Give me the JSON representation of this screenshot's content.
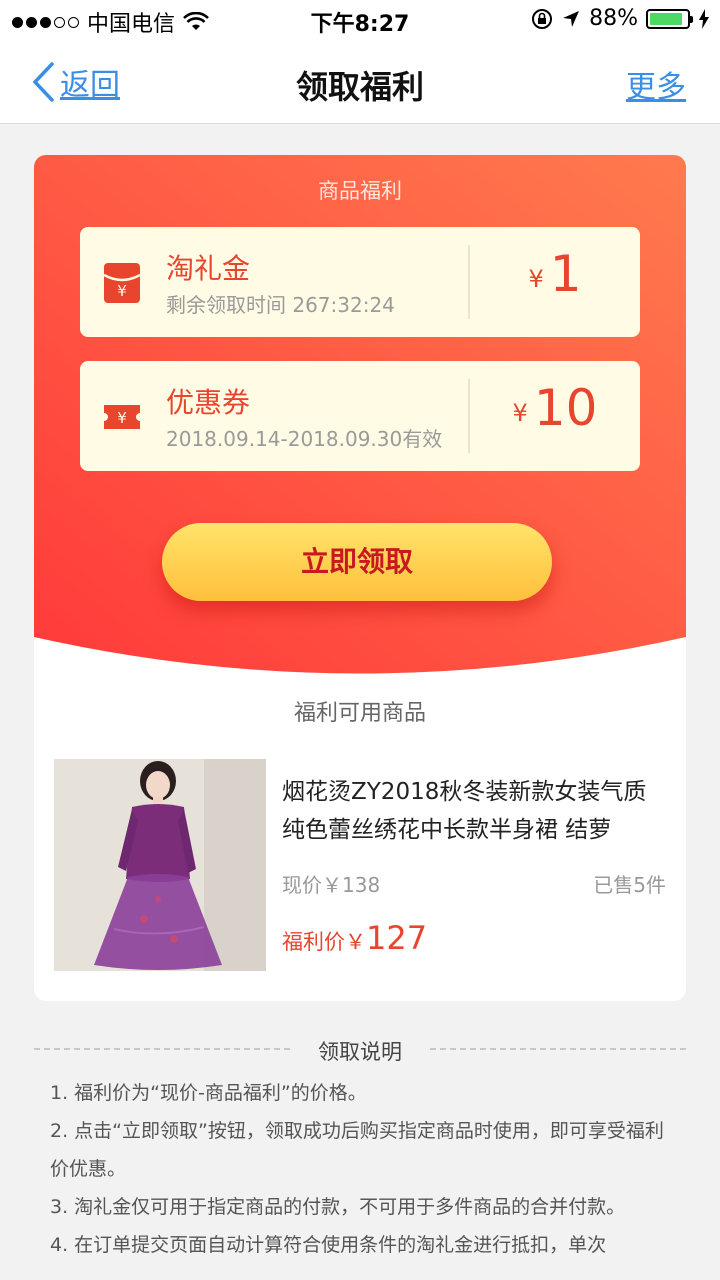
{
  "status_bar": {
    "carrier": "中国电信",
    "time": "下午8:27",
    "battery": "88%",
    "battery_level": 0.88
  },
  "nav": {
    "back_label": "返回",
    "title": "领取福利",
    "more_label": "更多"
  },
  "benefits": {
    "section_title": "商品福利",
    "gift_money": {
      "name": "淘礼金",
      "desc": "剩余领取时间 267:32:24",
      "currency": "¥",
      "amount": "1"
    },
    "coupon": {
      "name": "优惠券",
      "desc": "2018.09.14-2018.09.30有效",
      "currency": "¥",
      "amount": "10"
    },
    "claim_button": "立即领取"
  },
  "goods": {
    "section_title": "福利可用商品",
    "product": {
      "name": "烟花烫ZY2018秋冬装新款女装气质纯色蕾丝绣花中长款半身裙 结萝",
      "current_price": "现价￥138",
      "sold": "已售5件",
      "deal_label": "福利价￥",
      "deal_price": "127"
    }
  },
  "instructions": {
    "title": "领取说明",
    "items": [
      "1. 福利价为“现价-商品福利”的价格。",
      "2. 点击“立即领取”按钮，领取成功后购买指定商品时使用，即可享受福利价优惠。",
      "3. 淘礼金仅可用于指定商品的付款，不可用于多件商品的合并付款。",
      "4. 在订单提交页面自动计算符合使用条件的淘礼金进行抵扣，单次"
    ]
  },
  "colors": {
    "accent_blue": "#3b8ee6",
    "red_top": "#ff6a4a",
    "red_bottom": "#ff3b3b",
    "price_red": "#e8452f",
    "button_yellow": "#ffcf4a"
  }
}
